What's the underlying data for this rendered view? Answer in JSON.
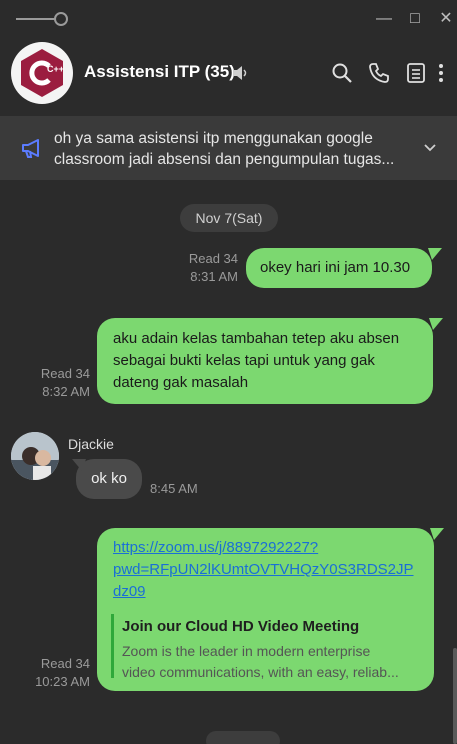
{
  "window": {
    "minimize": "—",
    "maximize": "□",
    "close": "✕"
  },
  "header": {
    "title": "Assistensi ITP (35)",
    "logo_text": "C++",
    "icons": [
      "search-icon",
      "phone-icon",
      "notes-icon",
      "more-vertical-icon"
    ]
  },
  "pinned": {
    "text": "oh ya sama asistensi itp menggunakan google classroom jadi absensi dan pengumpulan tugas..."
  },
  "chat": {
    "date": "Nov 7(Sat)",
    "messages": [
      {
        "dir": "out",
        "text": "okey hari ini jam 10.30",
        "read": "Read 34",
        "time": "8:31 AM"
      },
      {
        "dir": "out",
        "text": "aku adain kelas tambahan tetep aku absen sebagai bukti kelas tapi untuk yang gak dateng gak masalah",
        "read": "Read 34",
        "time": "8:32 AM"
      },
      {
        "dir": "in",
        "sender": "Djackie",
        "text": "ok ko",
        "time": "8:45 AM"
      },
      {
        "dir": "out",
        "link": "https://zoom.us/j/8897292227?pwd=RFpUN2lKUmtOVTVHQzY0S3RDS2JPdz09",
        "link_lines": [
          "https://zoom.us/j/8897292227?",
          "pwd=RFpUN2lKUmtOVTVHQzY0S3RDS2JP",
          "dz09"
        ],
        "preview_title": "Join our Cloud HD Video Meeting",
        "preview_desc_lines": [
          "Zoom is the leader in modern enterprise",
          "video communications, with an easy, reliab..."
        ],
        "read": "Read 34",
        "time": "10:23 AM"
      }
    ]
  },
  "colors": {
    "bubble_out": "#7cd870",
    "bubble_in": "#4a4a4a",
    "background": "#2b2b2b",
    "link": "#1a6fd6"
  }
}
